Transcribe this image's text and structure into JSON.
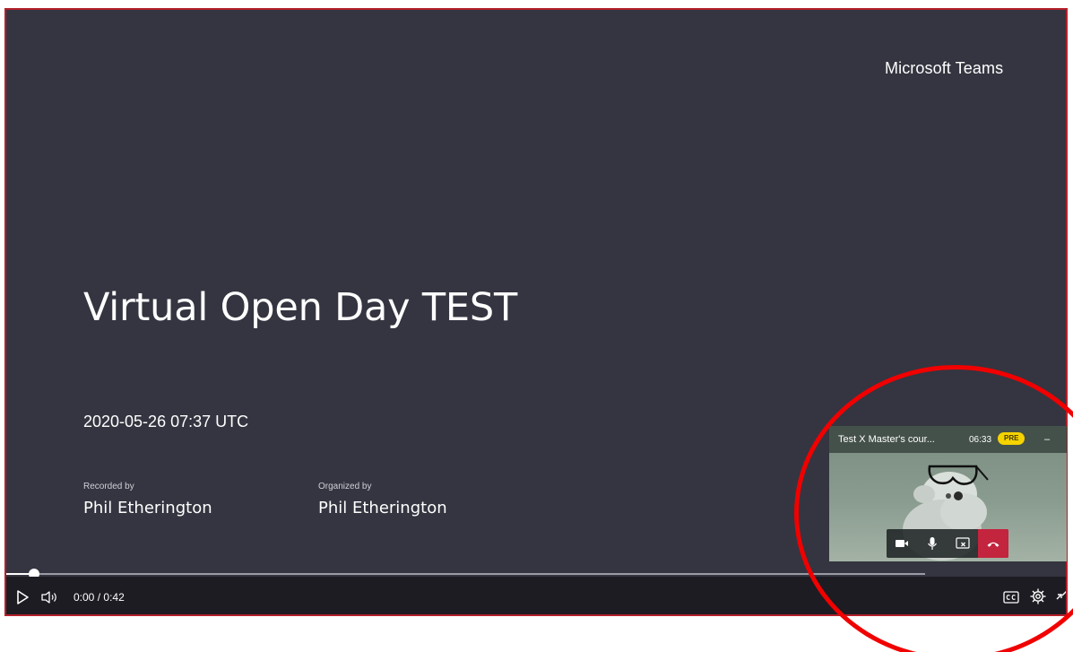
{
  "player": {
    "brand": "Microsoft Teams",
    "title": "Virtual Open Day TEST",
    "datetime": "2020-05-26 07:37 UTC",
    "recorded_by_label": "Recorded by",
    "recorded_by_name": "Phil Etherington",
    "organized_by_label": "Organized by",
    "organized_by_name": "Phil Etherington"
  },
  "controls": {
    "current_time": "0:00",
    "time_separator": "/",
    "duration": "0:42",
    "progress_fraction": 0.03
  },
  "mini_meeting": {
    "title": "Test X Master's cour...",
    "elapsed": "06:33",
    "badge": "PRE",
    "minimize": "–"
  },
  "icons": {
    "play": "play-icon",
    "volume": "volume-icon",
    "captions": "closed-captions-icon",
    "settings": "gear-icon",
    "collapse": "collapse-icon",
    "camera": "video-camera-icon",
    "microphone": "microphone-icon",
    "share": "share-screen-icon",
    "hangup": "hang-up-icon"
  },
  "colors": {
    "annotation": "#f10000",
    "badge": "#f5d300",
    "hangup": "#c3243e",
    "player_bg": "#343540"
  }
}
